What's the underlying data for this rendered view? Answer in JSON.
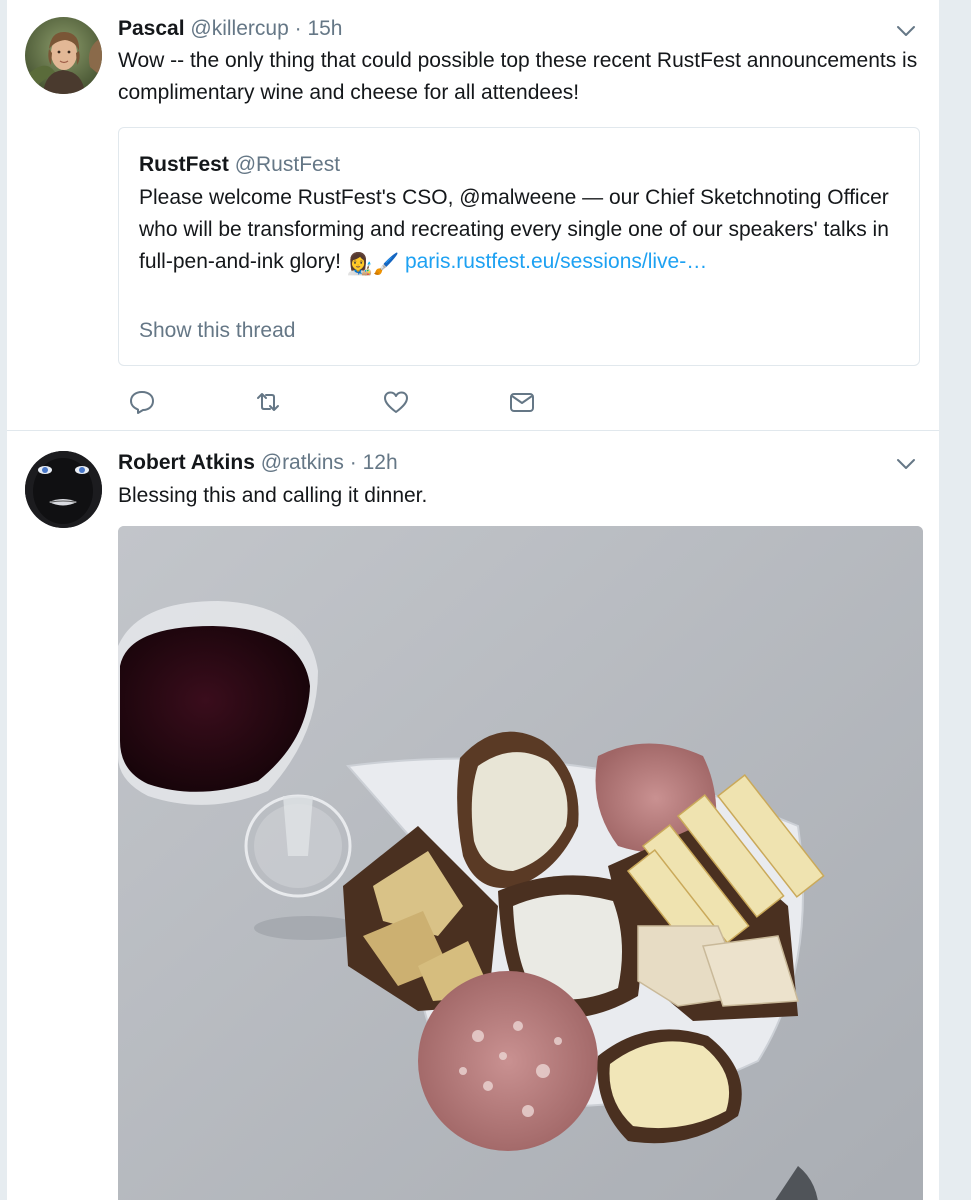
{
  "tweets": [
    {
      "author_name": "Pascal",
      "author_handle": "@killercup",
      "separator": "·",
      "time": "15h",
      "text": "Wow -- the only thing that could possible top these recent RustFest announcements is complimentary wine and cheese for all attendees!",
      "avatar_icon": "person-photo",
      "quoted": {
        "author_name": "RustFest",
        "author_handle": "@RustFest",
        "text_before": "Please welcome RustFest's CSO, @malweene — our Chief Sketchnoting Officer who will be transforming and recreating every single one of our speakers' talks in full-pen-and-ink glory!",
        "emoji_1": "👩‍🎨",
        "emoji_2": "🖌️",
        "link": "paris.rustfest.eu/sessions/live-…",
        "show_thread": "Show this thread"
      },
      "actions": [
        "reply-icon",
        "retweet-icon",
        "like-icon",
        "dm-icon"
      ]
    },
    {
      "author_name": "Robert Atkins",
      "author_handle": "@ratkins",
      "separator": "·",
      "time": "12h",
      "text": "Blessing this and calling it dinner.",
      "avatar_icon": "dark-face-avatar",
      "media": "photo of wine glass and plate of bread, cheese and salami"
    }
  ],
  "colors": {
    "accent": "#1da1f2",
    "secondary_text": "#657786",
    "border": "#e1e8ed",
    "background": "#e6ecf0"
  }
}
